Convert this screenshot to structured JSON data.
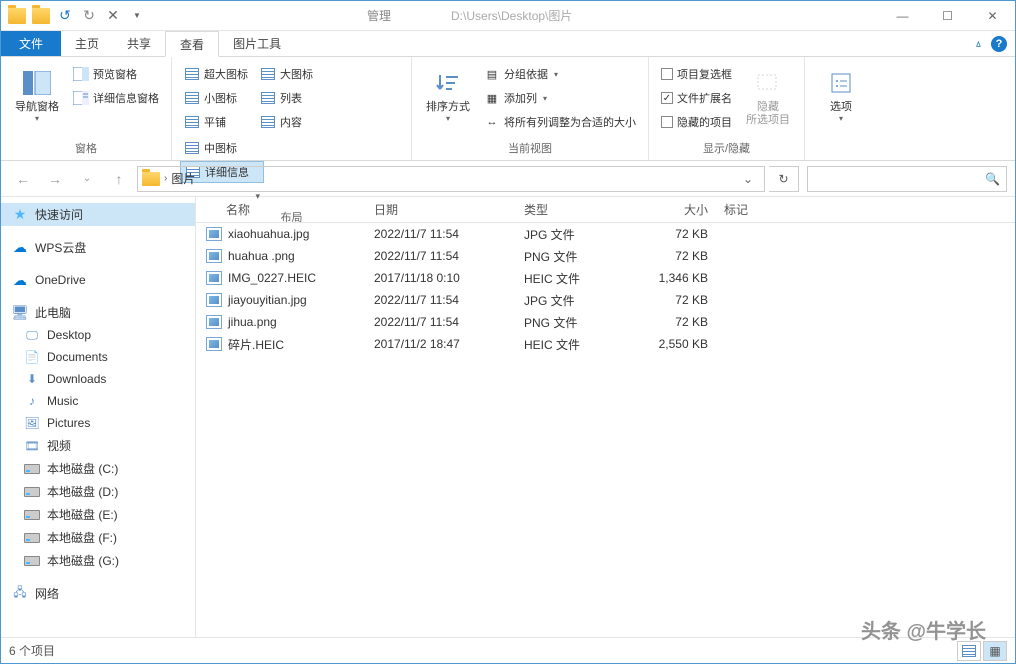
{
  "title_path": "D:\\Users\\Desktop\\图片",
  "manage_tab": "管理",
  "menu": {
    "file": "文件",
    "tabs": [
      "主页",
      "共享",
      "查看",
      "图片工具"
    ],
    "active": "查看"
  },
  "ribbon": {
    "panes_group": {
      "nav_pane": "导航窗格",
      "preview_pane": "预览窗格",
      "details_pane": "详细信息窗格",
      "label": "窗格"
    },
    "layout_group": {
      "extra_large": "超大图标",
      "large": "大图标",
      "medium": "中图标",
      "small": "小图标",
      "list": "列表",
      "details": "详细信息",
      "tiles": "平铺",
      "content": "内容",
      "label": "布局"
    },
    "view_group": {
      "sort": "排序方式",
      "group_by": "分组依据",
      "add_cols": "添加列",
      "fit_cols": "将所有列调整为合适的大小",
      "label": "当前视图"
    },
    "showhide_group": {
      "checkboxes": "项目复选框",
      "extensions": "文件扩展名",
      "hidden": "隐藏的项目",
      "hide": "隐藏",
      "hide_sub": "所选项目",
      "label": "显示/隐藏"
    },
    "options": "选项"
  },
  "address": {
    "segment": "图片"
  },
  "columns": {
    "name": "名称",
    "date": "日期",
    "type": "类型",
    "size": "大小",
    "tag": "标记"
  },
  "files": [
    {
      "name": "xiaohuahua.jpg",
      "date": "2022/11/7 11:54",
      "type": "JPG 文件",
      "size": "72 KB"
    },
    {
      "name": "huahua .png",
      "date": "2022/11/7 11:54",
      "type": "PNG 文件",
      "size": "72 KB"
    },
    {
      "name": "IMG_0227.HEIC",
      "date": "2017/11/18 0:10",
      "type": "HEIC 文件",
      "size": "1,346 KB"
    },
    {
      "name": "jiayouyitian.jpg",
      "date": "2022/11/7 11:54",
      "type": "JPG 文件",
      "size": "72 KB"
    },
    {
      "name": "jihua.png",
      "date": "2022/11/7 11:54",
      "type": "PNG 文件",
      "size": "72 KB"
    },
    {
      "name": "碎片.HEIC",
      "date": "2017/11/2 18:47",
      "type": "HEIC 文件",
      "size": "2,550 KB"
    }
  ],
  "sidebar": {
    "quick": "快速访问",
    "wps": "WPS云盘",
    "onedrive": "OneDrive",
    "pc": "此电脑",
    "desktop": "Desktop",
    "documents": "Documents",
    "downloads": "Downloads",
    "music": "Music",
    "pictures": "Pictures",
    "video": "视频",
    "c": "本地磁盘 (C:)",
    "d": "本地磁盘 (D:)",
    "e": "本地磁盘 (E:)",
    "f": "本地磁盘 (F:)",
    "g": "本地磁盘 (G:)",
    "network": "网络"
  },
  "status": "6 个项目",
  "watermark": "头条 @牛学长"
}
